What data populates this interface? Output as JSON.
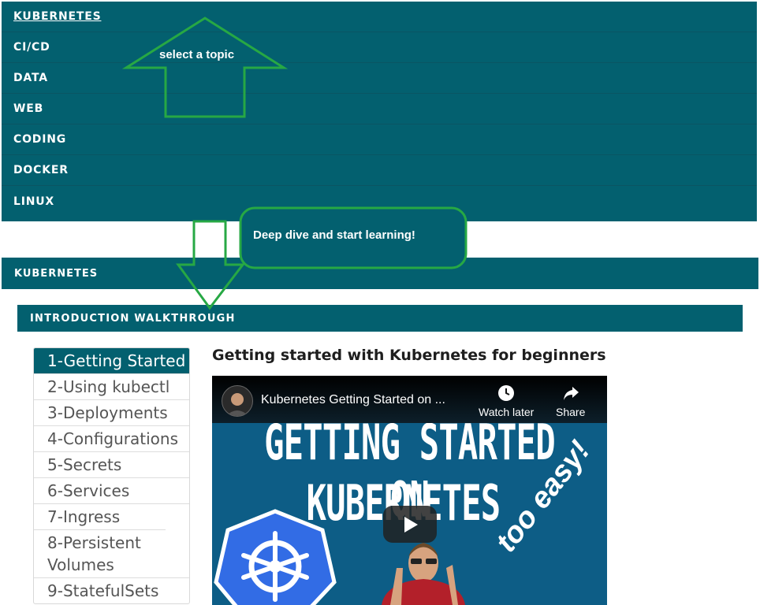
{
  "topnav": {
    "items": [
      {
        "label": "KUBERNETES",
        "active": true
      },
      {
        "label": "CI/CD"
      },
      {
        "label": "DATA"
      },
      {
        "label": "WEB"
      },
      {
        "label": "CODING"
      },
      {
        "label": "DOCKER"
      },
      {
        "label": "LINUX"
      }
    ]
  },
  "annotations": {
    "up_arrow_text": "select a topic",
    "callout_text": "Deep dive and start learning!",
    "color": "#27a844"
  },
  "section": {
    "title": "KUBERNETES",
    "subsection_title": "INTRODUCTION WALKTHROUGH"
  },
  "lessons": [
    {
      "label": "1-Getting Started",
      "active": true
    },
    {
      "label": "2-Using kubectl"
    },
    {
      "label": "3-Deployments"
    },
    {
      "label": "4-Configurations"
    },
    {
      "label": "5-Secrets"
    },
    {
      "label": "6-Services"
    },
    {
      "label": "7-Ingress"
    },
    {
      "label": "8-Persistent Volumes"
    },
    {
      "label": "9-StatefulSets"
    }
  ],
  "article": {
    "title": "Getting started with Kubernetes for beginners"
  },
  "video": {
    "title": "Kubernetes Getting Started on ...",
    "watch_later": "Watch later",
    "share": "Share",
    "thumb_line1": "GETTING STARTED ON",
    "thumb_line2": "KUBERNETES",
    "thumb_badge": "too easy!"
  },
  "colors": {
    "primary": "#03606f",
    "annotation": "#27a844",
    "video_bg": "#0d5d86"
  }
}
